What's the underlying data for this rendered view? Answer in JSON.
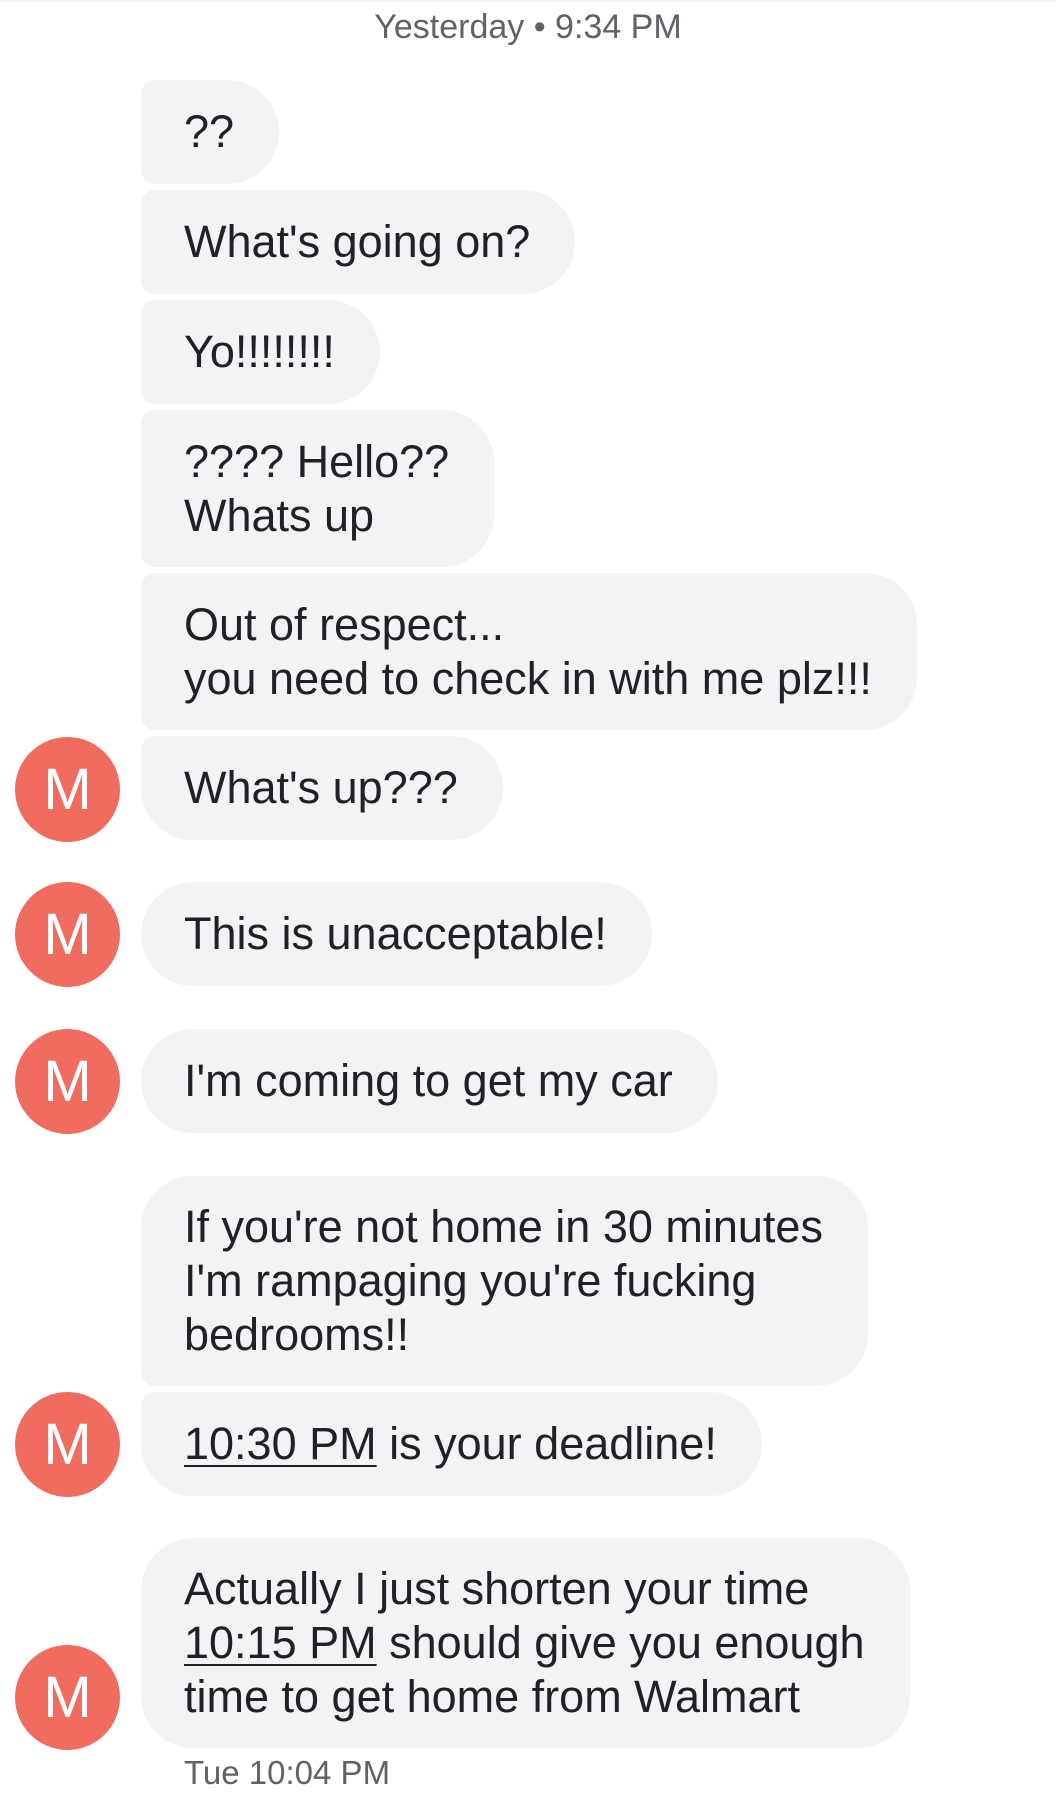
{
  "header": {
    "timestamp": "Yesterday • 9:34 PM"
  },
  "avatar_letter": "M",
  "messages": [
    {
      "lines": [
        "??"
      ]
    },
    {
      "lines": [
        "What's going on?"
      ]
    },
    {
      "lines": [
        "Yo!!!!!!!!"
      ]
    },
    {
      "lines": [
        "???? Hello??",
        "Whats up"
      ]
    },
    {
      "lines": [
        "Out of respect...",
        "you need to check in with me plz!!!"
      ]
    },
    {
      "lines": [
        "What's up???"
      ]
    },
    {
      "lines": [
        "This is unacceptable!"
      ]
    },
    {
      "lines": [
        "I'm coming to get my car"
      ]
    },
    {
      "lines": [
        "If you're not home in 30 minutes",
        "I'm rampaging you're fucking",
        "bedrooms!!"
      ]
    },
    {
      "link": "10:30 PM",
      "rest": " is your deadline!"
    },
    {
      "line1": "Actually I just shorten your time",
      "link": "10:15 PM",
      "line2_rest": " should give you enough",
      "line3": "time to get home from Walmart"
    }
  ],
  "footer": {
    "timestamp": "Tue 10:04 PM"
  },
  "colors": {
    "bubble": "#f1f3f4",
    "avatar": "#ef6c5f",
    "meta_text": "#5f6368"
  }
}
